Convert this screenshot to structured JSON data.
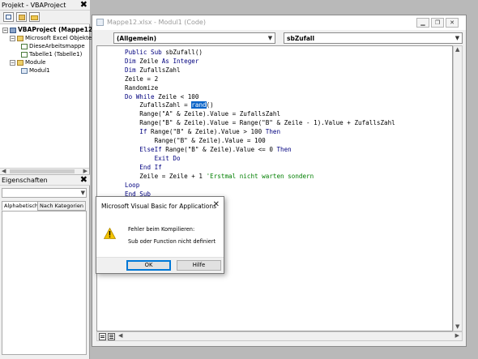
{
  "project_pane": {
    "title": "Projekt - VBAProject",
    "close_label": "✖",
    "tree": [
      {
        "label": "VBAProject (Mappe12.x",
        "icon": "project-icon"
      },
      {
        "label": "Microsoft Excel Objekte",
        "icon": "folder-icon"
      },
      {
        "label": "DieseArbeitsmappe",
        "icon": "workbook-icon"
      },
      {
        "label": "Tabelle1 (Tabelle1)",
        "icon": "worksheet-icon"
      },
      {
        "label": "Module",
        "icon": "folder-icon"
      },
      {
        "label": "Modul1",
        "icon": "module-icon"
      }
    ]
  },
  "properties_pane": {
    "title": "Eigenschaften",
    "close_label": "✖",
    "tabs": [
      "Alphabetisch",
      "Nach Kategorien"
    ]
  },
  "code_window": {
    "title": "Mappe12.xlsx - Modul1 (Code)",
    "object_combo": "(Allgemein)",
    "proc_combo": "sbZufall",
    "code_lines": [
      [
        {
          "t": "Public Sub",
          "k": "kw"
        },
        {
          "t": " sbZufall()"
        }
      ],
      [
        {
          "t": "Dim",
          "k": "kw"
        },
        {
          "t": " Zeile "
        },
        {
          "t": "As Integer",
          "k": "kw"
        }
      ],
      [
        {
          "t": "Dim",
          "k": "kw"
        },
        {
          "t": " ZufallsZahl"
        }
      ],
      [
        {
          "t": "Zeile = 2"
        }
      ],
      [
        {
          "t": "Randomize"
        }
      ],
      [
        {
          "t": "Do While",
          "k": "kw"
        },
        {
          "t": " Zeile < 100"
        }
      ],
      [
        {
          "t": "    ZufallsZahl = "
        },
        {
          "t": "rand",
          "k": "sel"
        },
        {
          "t": "()"
        }
      ],
      [
        {
          "t": "    Range(\"A\" & Zeile).Value = ZufallsZahl"
        }
      ],
      [
        {
          "t": "    Range(\"B\" & Zeile).Value = Range(\"B\" & Zeile - 1).Value + ZufallsZahl"
        }
      ],
      [
        {
          "t": "    "
        },
        {
          "t": "If",
          "k": "kw"
        },
        {
          "t": " Range(\"B\" & Zeile).Value > 100 "
        },
        {
          "t": "Then",
          "k": "kw"
        }
      ],
      [
        {
          "t": "        Range(\"B\" & Zeile).Value = 100"
        }
      ],
      [
        {
          "t": "    "
        },
        {
          "t": "ElseIf",
          "k": "kw"
        },
        {
          "t": " Range(\"B\" & Zeile).Value <= 0 "
        },
        {
          "t": "Then",
          "k": "kw"
        }
      ],
      [
        {
          "t": "        "
        },
        {
          "t": "Exit Do",
          "k": "kw"
        }
      ],
      [
        {
          "t": "    "
        },
        {
          "t": "End If",
          "k": "kw"
        }
      ],
      [
        {
          "t": "    Zeile = Zeile + 1 "
        },
        {
          "t": "'Erstmal nicht warten sondern",
          "k": "cm"
        }
      ],
      [
        {
          "t": "Loop",
          "k": "kw"
        }
      ],
      [
        {
          "t": "End Sub",
          "k": "kw"
        }
      ]
    ]
  },
  "dialog": {
    "title": "Microsoft Visual Basic for Applications",
    "close_label": "✕",
    "message_line1": "Fehler beim Kompilieren:",
    "message_line2": "Sub oder Function nicht definiert",
    "ok_label": "OK",
    "help_label": "Hilfe"
  },
  "colors": {
    "keyword": "#00007f",
    "comment": "#007f00",
    "selection": "#0a64c8",
    "background": "#b9b9b9"
  }
}
